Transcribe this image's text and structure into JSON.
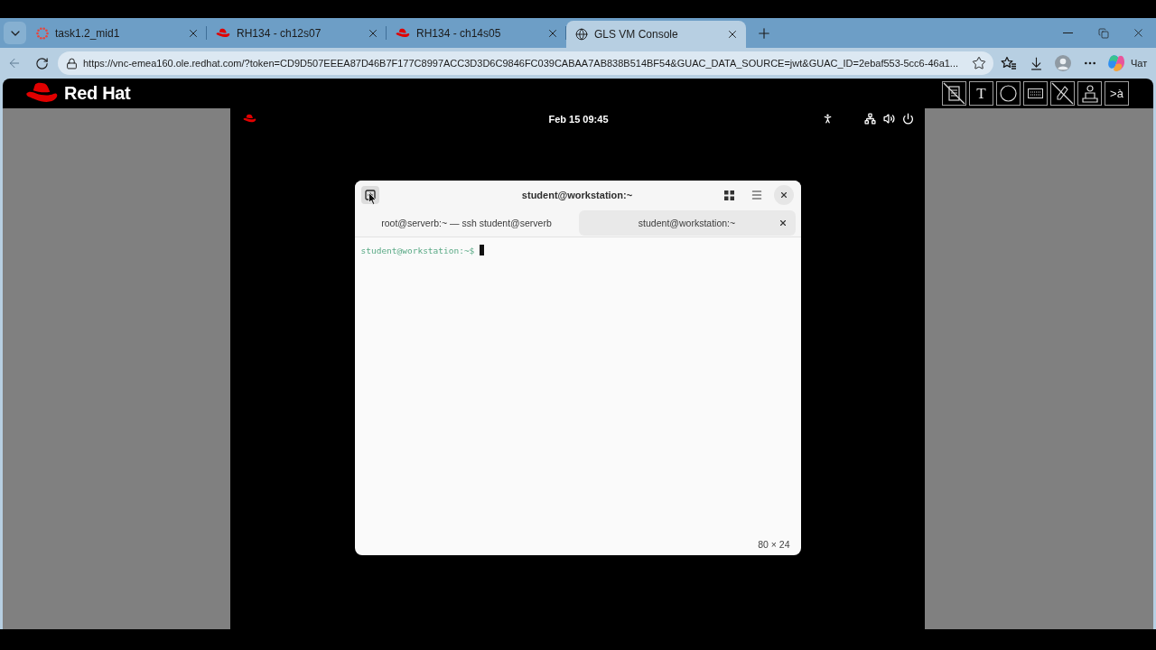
{
  "browser": {
    "tabs": [
      {
        "kind": "spinner",
        "title": "task1.2_mid1",
        "selected": false
      },
      {
        "kind": "hat",
        "title": "RH134 - ch12s07",
        "selected": false
      },
      {
        "kind": "hat",
        "title": "RH134 - ch14s05",
        "selected": false
      },
      {
        "kind": "globe",
        "title": "GLS VM Console",
        "selected": true
      }
    ],
    "address_bar": {
      "url": "https://vnc-emea160.ole.redhat.com/?token=CD9D507EEEA87D46B7F177C8997ACC3D3D6C9846FC039CABAA7AB838B514BF54&GUAC_DATA_SOURCE=jwt&GUAC_ID=2ebaf553-5cc6-46a1..."
    },
    "chat_label": "Чат"
  },
  "console": {
    "brand": "Red Hat",
    "toolbar": [
      {
        "kind": "clipboard"
      },
      {
        "kind": "label",
        "label": "T"
      },
      {
        "kind": "circle"
      },
      {
        "kind": "keyboard"
      },
      {
        "kind": "pen"
      },
      {
        "kind": "desk"
      },
      {
        "kind": "label",
        "label": ">à"
      }
    ]
  },
  "desktop": {
    "clock": "Feb 15 09:45"
  },
  "terminal": {
    "title": "student@workstation:~",
    "tabs": [
      {
        "title": "root@serverb:~ — ssh student@serverb",
        "selected": false
      },
      {
        "title": "student@workstation:~",
        "selected": true
      }
    ],
    "prompt": "student@workstation:~$",
    "size": "80 × 24"
  }
}
